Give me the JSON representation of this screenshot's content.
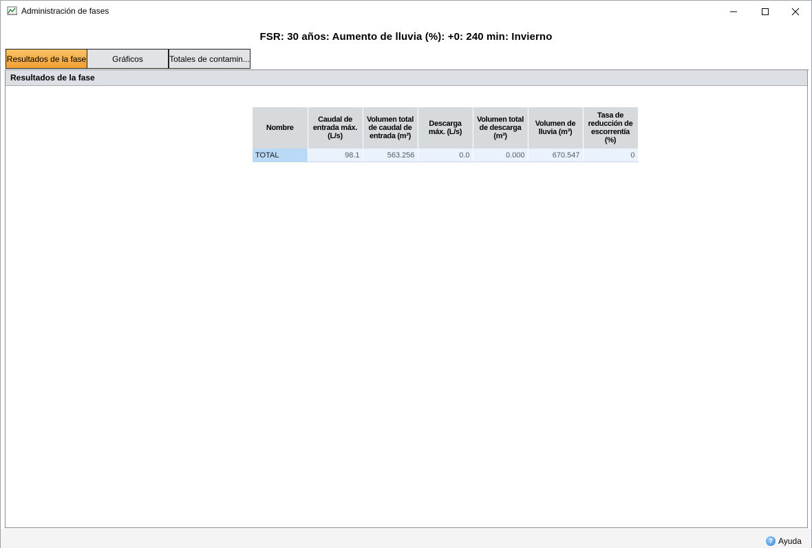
{
  "window": {
    "title": "Administración de fases",
    "minimize_glyph": "—",
    "maximize_glyph": "☐",
    "close_glyph": "✕"
  },
  "phase_title": "FSR: 30 años: Aumento de lluvia (%): +0: 240 min: Invierno",
  "tabs": [
    {
      "label": "Resultados de la fase",
      "active": true
    },
    {
      "label": "Gráficos",
      "active": false
    },
    {
      "label": "Totales de contamin...",
      "active": false
    }
  ],
  "section": {
    "header": "Resultados de la fase"
  },
  "table": {
    "columns": [
      "Nombre",
      "Caudal de entrada máx. (L/s)",
      "Volumen total de caudal de entrada (m³)",
      "Descarga máx. (L/s)",
      "Volumen total de descarga (m³)",
      "Volumen de lluvia (m³)",
      "Tasa de reducción de escorrentía (%)"
    ],
    "rows": [
      [
        "TOTAL",
        "98.1",
        "563.256",
        "0.0",
        "0.000",
        "670.547",
        "0"
      ]
    ]
  },
  "footer": {
    "help_label": "Ayuda",
    "help_icon": "help-icon"
  },
  "colors": {
    "active_tab": "#f1a032",
    "header_bg": "#dcdfe3",
    "selected_cell": "#b9d9f7"
  }
}
